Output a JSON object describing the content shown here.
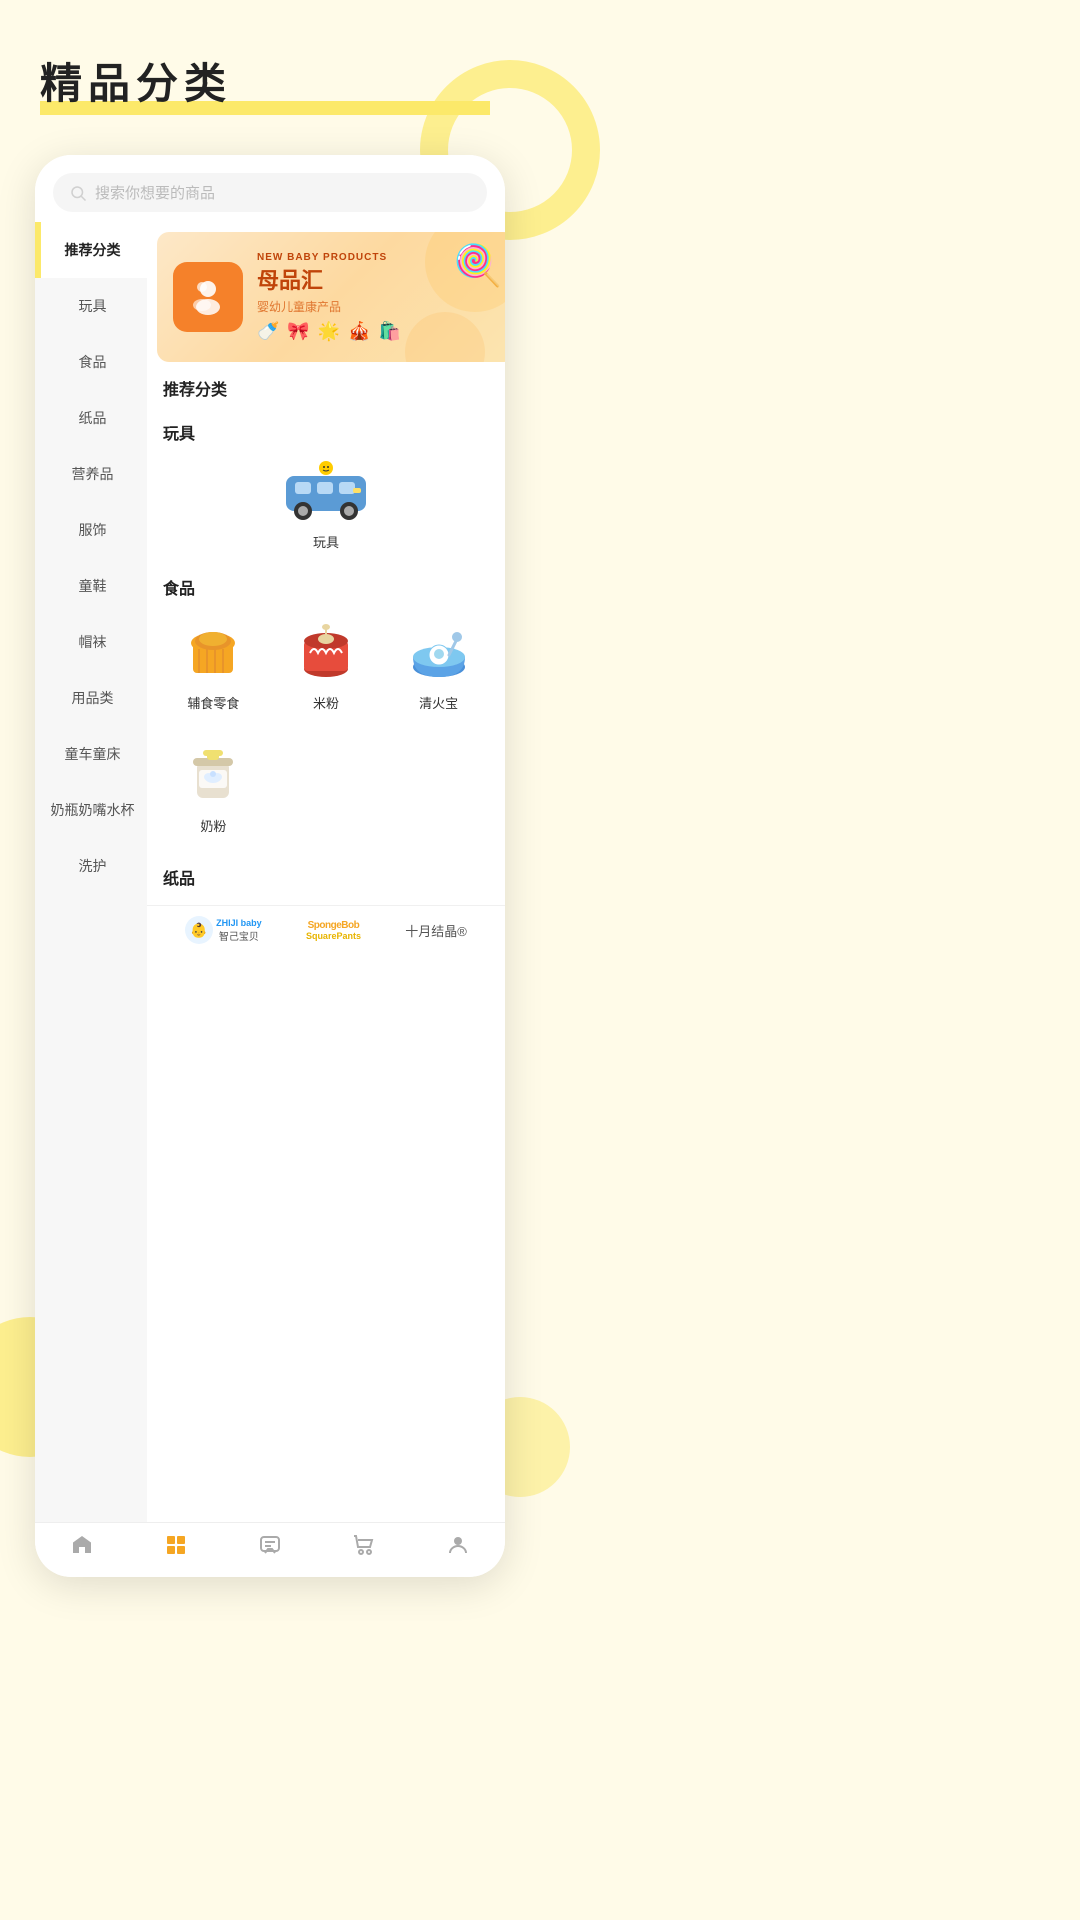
{
  "page": {
    "title": "精品分类",
    "title_underline_color": "#fce96a",
    "background_color": "#fffbe8"
  },
  "search": {
    "placeholder": "搜索你想要的商品"
  },
  "sidebar": {
    "items": [
      {
        "id": "recommended",
        "label": "推荐分类",
        "active": true
      },
      {
        "id": "toys",
        "label": "玩具",
        "active": false
      },
      {
        "id": "food",
        "label": "食品",
        "active": false
      },
      {
        "id": "paper",
        "label": "纸品",
        "active": false
      },
      {
        "id": "nutrition",
        "label": "营养品",
        "active": false
      },
      {
        "id": "clothing",
        "label": "服饰",
        "active": false
      },
      {
        "id": "shoes",
        "label": "童鞋",
        "active": false
      },
      {
        "id": "hats",
        "label": "帽袜",
        "active": false
      },
      {
        "id": "supplies",
        "label": "用品类",
        "active": false
      },
      {
        "id": "stroller",
        "label": "童车童床",
        "active": false
      },
      {
        "id": "bottle",
        "label": "奶瓶奶嘴水杯",
        "active": false
      },
      {
        "id": "care",
        "label": "洗护",
        "active": false
      }
    ]
  },
  "banner": {
    "title": "母品汇",
    "subtitle": "婴幼儿童康产品",
    "tag": "NEW BABY PRODUCTS"
  },
  "sections": [
    {
      "id": "recommended",
      "title": "推荐分类"
    },
    {
      "id": "toys",
      "title": "玩具",
      "items": [
        {
          "id": "toy",
          "label": "玩具",
          "emoji": "🚌"
        }
      ]
    },
    {
      "id": "food",
      "title": "食品",
      "items": [
        {
          "id": "complementary",
          "label": "辅食零食"
        },
        {
          "id": "rice_flour",
          "label": "米粉"
        },
        {
          "id": "qinghuobao",
          "label": "清火宝"
        },
        {
          "id": "milk_powder",
          "label": "奶粉"
        }
      ]
    },
    {
      "id": "paper",
      "title": "纸品"
    }
  ],
  "brands": [
    {
      "id": "zhiji",
      "name": "智己宝贝",
      "label": "ZHIJI baby 智己宝贝"
    },
    {
      "id": "spongebob",
      "name": "SpongeBob SquarePants",
      "label": "SpongeBob SquarePants"
    },
    {
      "id": "october",
      "name": "十月结晶",
      "label": "十月结晶®"
    }
  ],
  "bottom_nav": {
    "items": [
      {
        "id": "home",
        "label": "首页",
        "icon": "home",
        "active": false
      },
      {
        "id": "category",
        "label": "分类",
        "icon": "grid",
        "active": true
      },
      {
        "id": "message",
        "label": "消息",
        "icon": "chat",
        "active": false
      },
      {
        "id": "cart",
        "label": "购物车",
        "icon": "cart",
        "active": false
      },
      {
        "id": "profile",
        "label": "我的",
        "icon": "person",
        "active": false
      }
    ]
  }
}
